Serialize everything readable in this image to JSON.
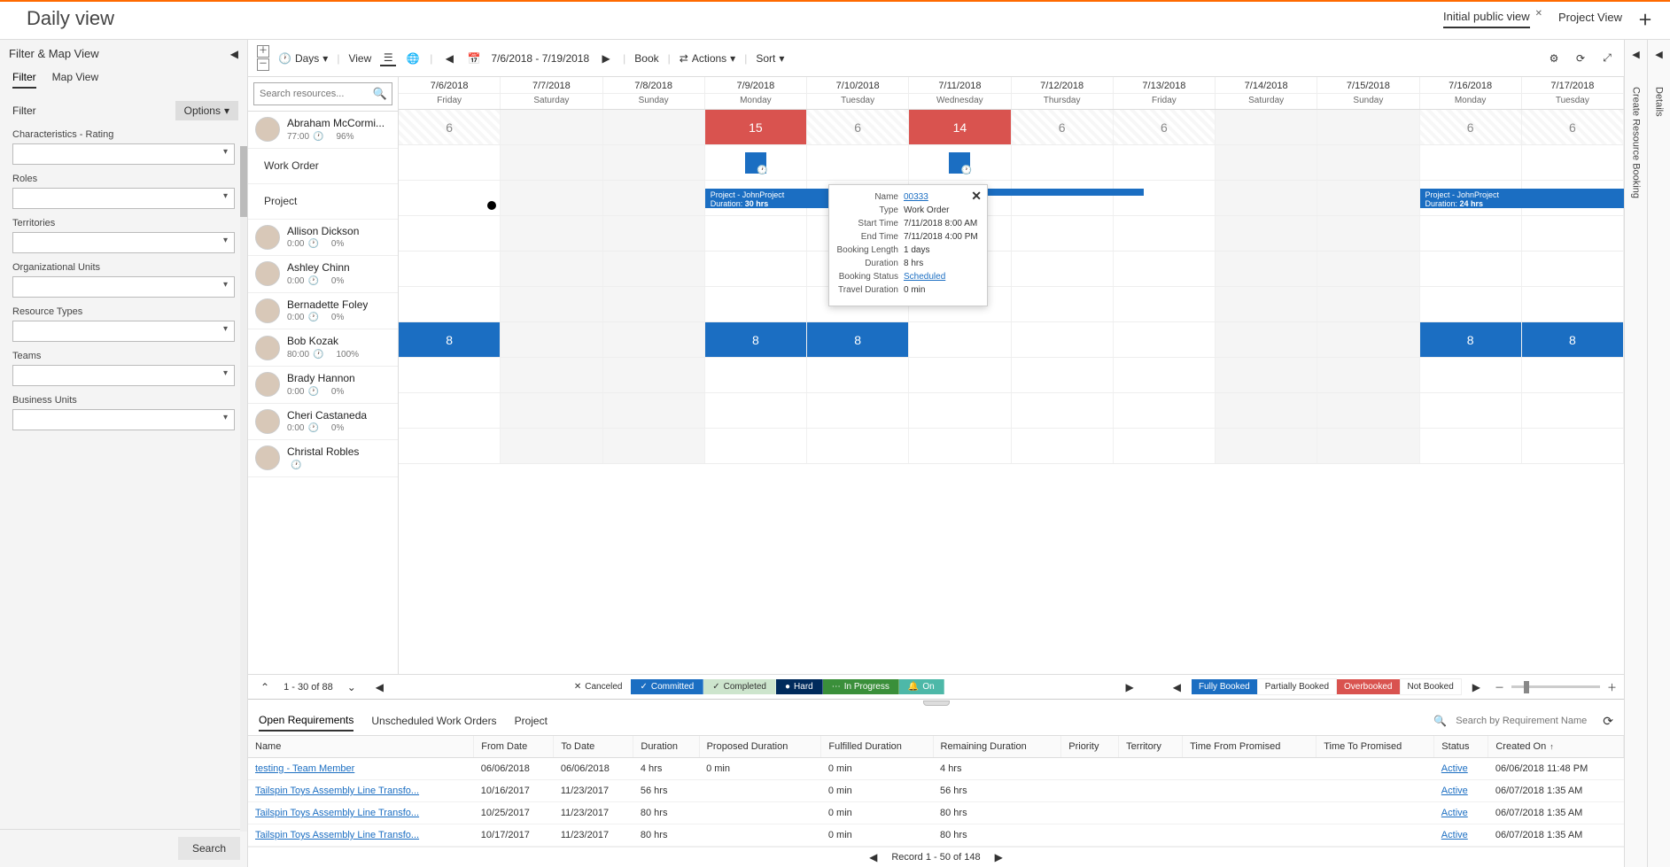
{
  "title": "Daily view",
  "views": {
    "initial": "Initial public view",
    "project": "Project View"
  },
  "sidebar": {
    "header": "Filter & Map View",
    "tabs": {
      "filter": "Filter",
      "map": "Map View"
    },
    "filterLabel": "Filter",
    "options": "Options",
    "groups": [
      "Characteristics - Rating",
      "Roles",
      "Territories",
      "Organizational Units",
      "Resource Types",
      "Teams",
      "Business Units"
    ],
    "searchBtn": "Search"
  },
  "toolbar": {
    "days": "Days",
    "view": "View",
    "dateRange": "7/6/2018 - 7/19/2018",
    "book": "Book",
    "actions": "Actions",
    "sort": "Sort"
  },
  "searchResources": {
    "placeholder": "Search resources..."
  },
  "dates": [
    {
      "d": "7/6/2018",
      "w": "Friday"
    },
    {
      "d": "7/7/2018",
      "w": "Saturday"
    },
    {
      "d": "7/8/2018",
      "w": "Sunday"
    },
    {
      "d": "7/9/2018",
      "w": "Monday"
    },
    {
      "d": "7/10/2018",
      "w": "Tuesday"
    },
    {
      "d": "7/11/2018",
      "w": "Wednesday"
    },
    {
      "d": "7/12/2018",
      "w": "Thursday"
    },
    {
      "d": "7/13/2018",
      "w": "Friday"
    },
    {
      "d": "7/14/2018",
      "w": "Saturday"
    },
    {
      "d": "7/15/2018",
      "w": "Sunday"
    },
    {
      "d": "7/16/2018",
      "w": "Monday"
    },
    {
      "d": "7/17/2018",
      "w": "Tuesday"
    }
  ],
  "resources": [
    {
      "name": "Abraham McCormi...",
      "hours": "77:00",
      "pct": "96%",
      "hoursRow": [
        "6",
        "",
        "",
        "15",
        "6",
        "14",
        "6",
        "6",
        "",
        "",
        "6",
        "6"
      ],
      "subRows": [
        "Work Order",
        "Project"
      ]
    },
    {
      "name": "Allison Dickson",
      "hours": "0:00",
      "pct": "0%"
    },
    {
      "name": "Ashley Chinn",
      "hours": "0:00",
      "pct": "0%"
    },
    {
      "name": "Bernadette Foley",
      "hours": "0:00",
      "pct": "0%"
    },
    {
      "name": "Bob Kozak",
      "hours": "80:00",
      "pct": "100%",
      "hoursRow": [
        "8",
        "",
        "",
        "8",
        "8",
        "",
        "",
        "",
        "",
        "",
        "8",
        "8"
      ]
    },
    {
      "name": "Brady Hannon",
      "hours": "0:00",
      "pct": "0%"
    },
    {
      "name": "Cheri Castaneda",
      "hours": "0:00",
      "pct": "0%"
    },
    {
      "name": "Christal Robles",
      "hours": "",
      "pct": ""
    }
  ],
  "projectBlocks": {
    "left": {
      "title": "Project - JohnProject",
      "duration": "Duration: ",
      "hrs": "30 hrs"
    },
    "right": {
      "title": "Project - JohnProject",
      "duration": "Duration: ",
      "hrs": "24 hrs"
    }
  },
  "tooltip": {
    "rows": [
      {
        "label": "Name",
        "value": "00333",
        "link": true
      },
      {
        "label": "Type",
        "value": "Work Order"
      },
      {
        "label": "Start Time",
        "value": "7/11/2018 8:00 AM"
      },
      {
        "label": "End Time",
        "value": "7/11/2018 4:00 PM"
      },
      {
        "label": "Booking Length",
        "value": "1 days"
      },
      {
        "label": "Duration",
        "value": "8 hrs"
      },
      {
        "label": "Booking Status",
        "value": "Scheduled",
        "link": true
      },
      {
        "label": "Travel Duration",
        "value": "0 min"
      }
    ]
  },
  "pager": {
    "range": "1 - 30 of 88"
  },
  "legend": {
    "canceled": "Canceled",
    "committed": "Committed",
    "completed": "Completed",
    "hard": "Hard",
    "inprogress": "In Progress",
    "on": "On"
  },
  "booked": {
    "fully": "Fully Booked",
    "partial": "Partially Booked",
    "over": "Overbooked",
    "not": "Not Booked"
  },
  "rightPanels": {
    "details": "Details",
    "create": "Create Resource Booking"
  },
  "bottom": {
    "tabs": {
      "open": "Open Requirements",
      "unscheduled": "Unscheduled Work Orders",
      "project": "Project"
    },
    "searchPlaceholder": "Search by Requirement Name",
    "headers": [
      "Name",
      "From Date",
      "To Date",
      "Duration",
      "Proposed Duration",
      "Fulfilled Duration",
      "Remaining Duration",
      "Priority",
      "Territory",
      "Time From Promised",
      "Time To Promised",
      "Status",
      "Created On"
    ],
    "rows": [
      {
        "name": "testing - Team Member",
        "from": "06/06/2018",
        "to": "06/06/2018",
        "dur": "4 hrs",
        "proposed": "0 min",
        "fulfilled": "0 min",
        "remaining": "4 hrs",
        "status": "Active",
        "created": "06/06/2018 11:48 PM"
      },
      {
        "name": "Tailspin Toys Assembly Line Transfo...",
        "from": "10/16/2017",
        "to": "11/23/2017",
        "dur": "56 hrs",
        "proposed": "",
        "fulfilled": "0 min",
        "remaining": "56 hrs",
        "status": "Active",
        "created": "06/07/2018 1:35 AM"
      },
      {
        "name": "Tailspin Toys Assembly Line Transfo...",
        "from": "10/25/2017",
        "to": "11/23/2017",
        "dur": "80 hrs",
        "proposed": "",
        "fulfilled": "0 min",
        "remaining": "80 hrs",
        "status": "Active",
        "created": "06/07/2018 1:35 AM"
      },
      {
        "name": "Tailspin Toys Assembly Line Transfo...",
        "from": "10/17/2017",
        "to": "11/23/2017",
        "dur": "80 hrs",
        "proposed": "",
        "fulfilled": "0 min",
        "remaining": "80 hrs",
        "status": "Active",
        "created": "06/07/2018 1:35 AM"
      }
    ],
    "pager": "Record 1 - 50 of 148"
  }
}
